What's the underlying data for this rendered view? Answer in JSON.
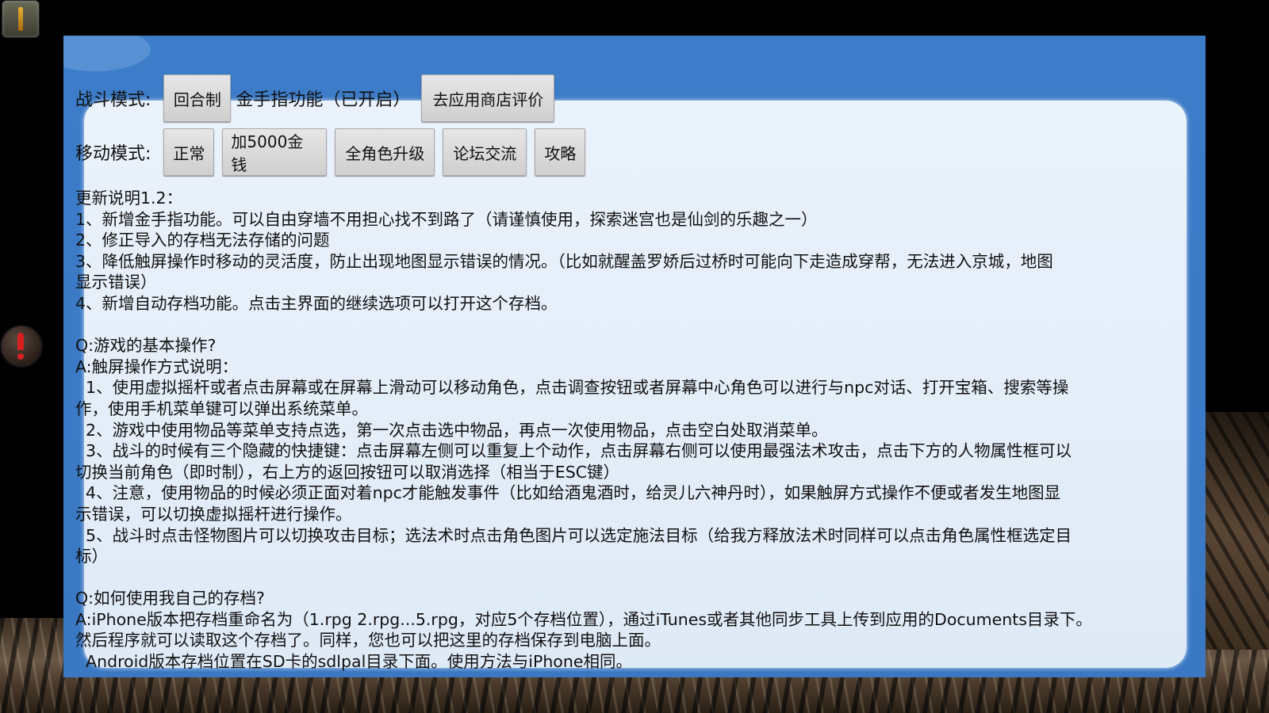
{
  "controls": {
    "battle_mode": {
      "label": "战斗模式:",
      "mode_button": "回合制",
      "cheat_status": "金手指功能（已开启）",
      "rate_button": "去应用商店评价"
    },
    "move_mode": {
      "label": "移动模式:",
      "buttons": [
        "正常",
        "加5000金钱",
        "全角色升级",
        "论坛交流",
        "攻略"
      ]
    }
  },
  "notes": {
    "lines": [
      "更新说明1.2：",
      "1、新增金手指功能。可以自由穿墙不用担心找不到路了（请谨慎使用，探索迷宫也是仙剑的乐趣之一）",
      "2、修正导入的存档无法存储的问题",
      "3、降低触屏操作时移动的灵活度，防止出现地图显示错误的情况。（比如就醒盖罗娇后过桥时可能向下走造成穿帮，无法进入京城，地图",
      "显示错误）",
      "4、新增自动存档功能。点击主界面的继续选项可以打开这个存档。",
      "",
      "Q:游戏的基本操作?",
      "A:触屏操作方式说明：",
      "  1、使用虚拟摇杆或者点击屏幕或在屏幕上滑动可以移动角色，点击调查按钮或者屏幕中心角色可以进行与npc对话、打开宝箱、搜索等操",
      "作，使用手机菜单键可以弹出系统菜单。",
      "  2、游戏中使用物品等菜单支持点选，第一次点击选中物品，再点一次使用物品，点击空白处取消菜单。",
      "  3、战斗的时候有三个隐藏的快捷键：点击屏幕左侧可以重复上个动作，点击屏幕右侧可以使用最强法术攻击，点击下方的人物属性框可以",
      "切换当前角色（即时制），右上方的返回按钮可以取消选择（相当于ESC键）",
      "  4、注意，使用物品的时候必须正面对着npc才能触发事件（比如给酒鬼酒时，给灵儿六神丹时），如果触屏方式操作不便或者发生地图显",
      "示错误，可以切换虚拟摇杆进行操作。",
      "  5、战斗时点击怪物图片可以切换攻击目标；选法术时点击角色图片可以选定施法目标（给我方释放法术时同样可以点击角色属性框选定目",
      "标）",
      "",
      "Q:如何使用我自己的存档?",
      "A:iPhone版本把存档重命名为（1.rpg 2.rpg...5.rpg，对应5个存档位置），通过iTunes或者其他同步工具上传到应用的Documents目录下。",
      "然后程序就可以读取这个存档了。同样，您也可以把这里的存档保存到电脑上面。",
      "  Android版本存档位置在SD卡的sdlpal目录下面。使用方法与iPhone相同。"
    ]
  },
  "icons": {
    "menu": "menu-lever-icon",
    "alert": "exclamation-icon"
  },
  "colors": {
    "panel_blue": "#3d7cc8",
    "panel_inner": "#eaf2fb",
    "button_face": "#dcdcdc"
  }
}
